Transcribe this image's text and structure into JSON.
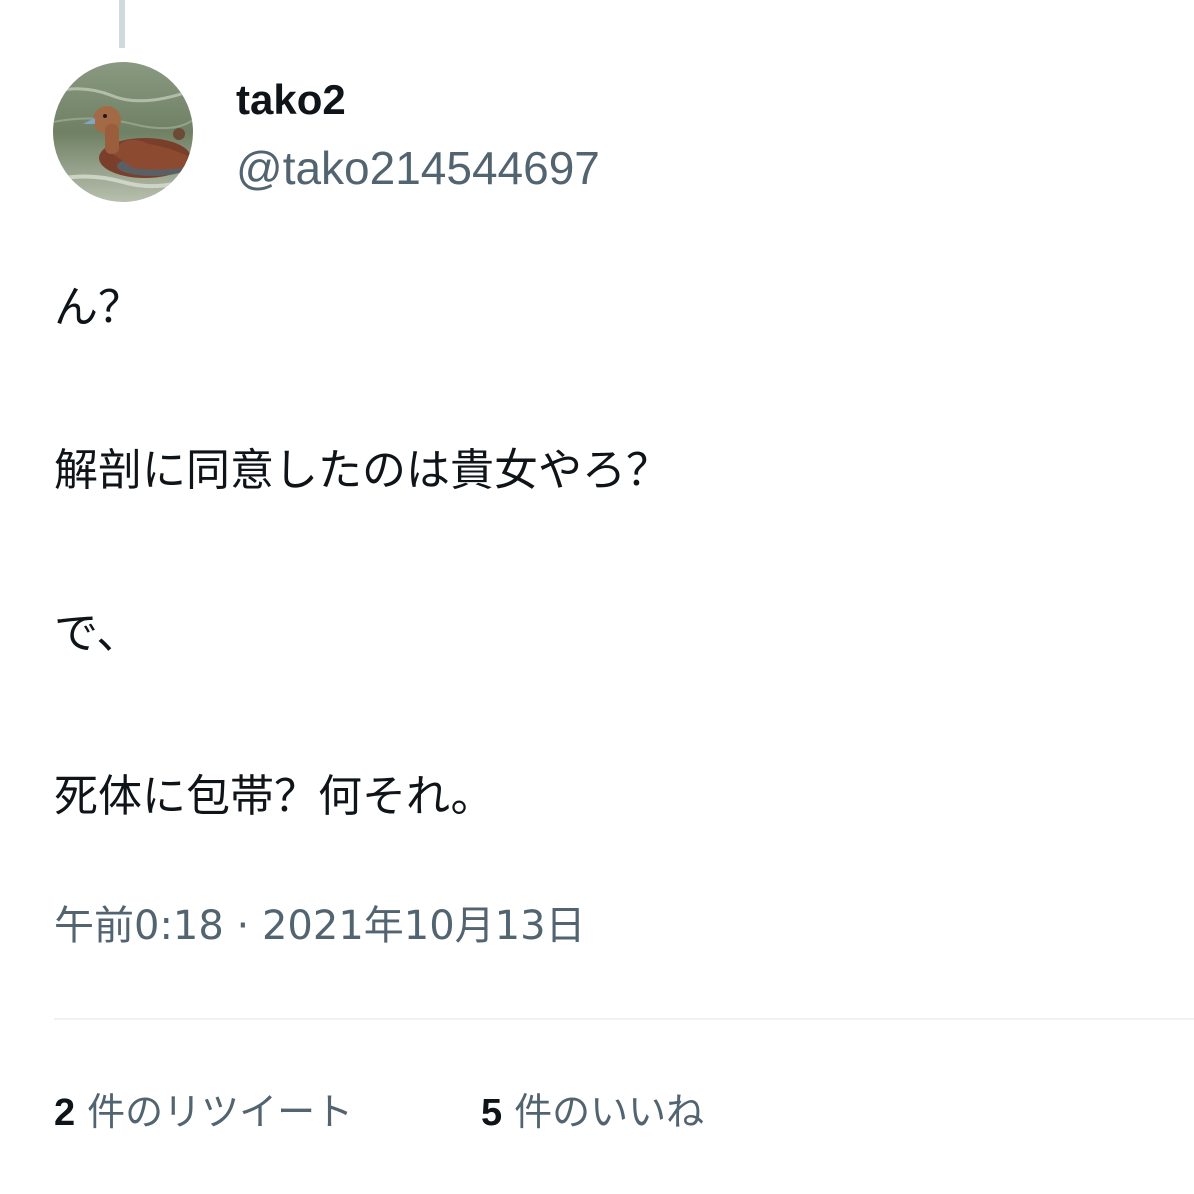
{
  "user": {
    "display_name": "tako2",
    "handle": "@tako214544697",
    "avatar_icon": "duck-photo-avatar"
  },
  "tweet": {
    "lines": [
      "ん？",
      "解剖に同意したのは貴女やろ？",
      "で、",
      "死体に包帯？何それ。"
    ],
    "timestamp": "午前0:18 · 2021年10月13日"
  },
  "stats": {
    "retweets": {
      "count": "2",
      "label": "件のリツイート"
    },
    "likes": {
      "count": "5",
      "label": "件のいいね"
    }
  },
  "colors": {
    "primary_text": "#0f1419",
    "secondary_text": "#536471",
    "divider": "#eff3f4",
    "thread_line": "#cfd9de"
  }
}
